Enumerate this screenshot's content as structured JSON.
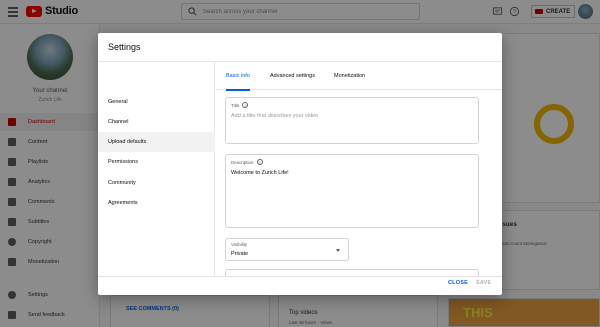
{
  "header": {
    "logo_text": "Studio",
    "search_placeholder": "Search across your channel",
    "create_label": "CREATE"
  },
  "sidebar": {
    "channel_label": "Your channel",
    "channel_name": "Zurich Life",
    "items": [
      {
        "label": "Dashboard",
        "icon": "dashboard-icon"
      },
      {
        "label": "Content",
        "icon": "content-icon"
      },
      {
        "label": "Playlists",
        "icon": "playlists-icon"
      },
      {
        "label": "Analytics",
        "icon": "analytics-icon"
      },
      {
        "label": "Comments",
        "icon": "comments-icon"
      },
      {
        "label": "Subtitles",
        "icon": "subtitles-icon"
      },
      {
        "label": "Copyright",
        "icon": "copyright-icon"
      },
      {
        "label": "Monetization",
        "icon": "monetization-icon"
      },
      {
        "label": "Settings",
        "icon": "settings-icon"
      },
      {
        "label": "Send feedback",
        "icon": "feedback-icon"
      }
    ]
  },
  "background": {
    "see_comments": "SEE COMMENTS (0)",
    "top_videos": "Top videos",
    "top_videos_sub": "Last 48 hours · Views",
    "news_heading": "n issues",
    "news_sub": "auto count Monegasca",
    "thumb_text": "THIS"
  },
  "dialog": {
    "title": "Settings",
    "nav": [
      "General",
      "Channel",
      "Upload defaults",
      "Permissions",
      "Community",
      "Agreements"
    ],
    "tabs": [
      "Basic info",
      "Advanced settings",
      "Monetization"
    ],
    "title_field": {
      "label": "Title",
      "placeholder": "Add a title that describes your video"
    },
    "description_field": {
      "label": "Description",
      "value": "Welcome to Zurich Life!"
    },
    "visibility_field": {
      "label": "Visibility",
      "value": "Private"
    },
    "buttons": {
      "close": "CLOSE",
      "save": "SAVE"
    }
  },
  "colors": {
    "accent_blue": "#065fd4",
    "brand_red": "#ff0000"
  }
}
